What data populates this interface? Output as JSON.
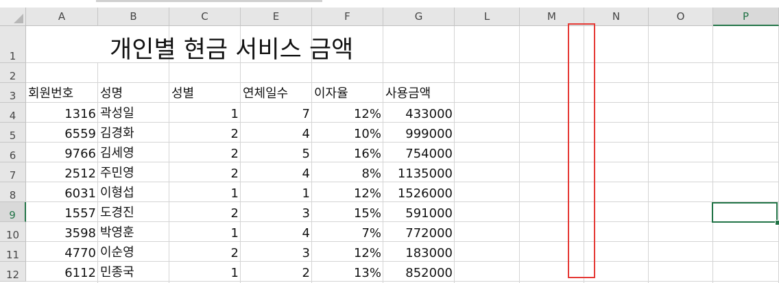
{
  "sheet": {
    "columns": [
      "A",
      "B",
      "C",
      "E",
      "F",
      "G",
      "L",
      "M",
      "N",
      "O",
      "P"
    ],
    "rows": [
      "1",
      "2",
      "3",
      "4",
      "5",
      "6",
      "7",
      "8",
      "9",
      "10",
      "11",
      "12"
    ],
    "selected_column": "P",
    "selected_row": "9",
    "title": "개인별 현금 서비스 금액",
    "headers": [
      "회원번호",
      "성명",
      "성별",
      "연체일수",
      "이자율",
      "사용금액"
    ],
    "records": [
      {
        "id": "1316",
        "name": "곽성일",
        "gender": "1",
        "overdue": "7",
        "rate": "12%",
        "amount": "433000"
      },
      {
        "id": "6559",
        "name": "김경화",
        "gender": "2",
        "overdue": "4",
        "rate": "10%",
        "amount": "999000"
      },
      {
        "id": "9766",
        "name": "김세영",
        "gender": "2",
        "overdue": "5",
        "rate": "16%",
        "amount": "754000"
      },
      {
        "id": "2512",
        "name": "주민영",
        "gender": "2",
        "overdue": "4",
        "rate": "8%",
        "amount": "1135000"
      },
      {
        "id": "6031",
        "name": "이형섭",
        "gender": "1",
        "overdue": "1",
        "rate": "12%",
        "amount": "1526000"
      },
      {
        "id": "1557",
        "name": "도경진",
        "gender": "2",
        "overdue": "3",
        "rate": "15%",
        "amount": "591000"
      },
      {
        "id": "3598",
        "name": "박영훈",
        "gender": "1",
        "overdue": "4",
        "rate": "7%",
        "amount": "772000"
      },
      {
        "id": "4770",
        "name": "이순영",
        "gender": "2",
        "overdue": "3",
        "rate": "12%",
        "amount": "183000"
      },
      {
        "id": "6112",
        "name": "민종국",
        "gender": "1",
        "overdue": "2",
        "rate": "13%",
        "amount": "852000"
      }
    ],
    "colors": {
      "accent": "#217346",
      "highlight": "#e53935",
      "header_bg": "#e6e6e6",
      "grid": "#d4d4d4"
    }
  }
}
